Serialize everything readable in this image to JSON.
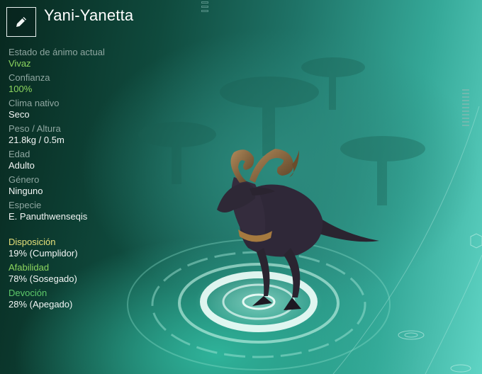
{
  "creature": {
    "name": "Yani-Yanetta"
  },
  "stats": [
    {
      "label": "Estado de ánimo actual",
      "value": "Vivaz",
      "highlight": true
    },
    {
      "label": "Confianza",
      "value": "100%",
      "highlight": true
    },
    {
      "label": "Clima nativo",
      "value": "Seco",
      "highlight": false
    },
    {
      "label": "Peso / Altura",
      "value": "21.8kg / 0.5m",
      "highlight": false
    },
    {
      "label": "Edad",
      "value": "Adulto",
      "highlight": false
    },
    {
      "label": "Género",
      "value": "Ninguno",
      "highlight": false
    },
    {
      "label": "Especie",
      "value": "E. Panuthwenseqis",
      "highlight": false
    }
  ],
  "traits": [
    {
      "label": "Disposición",
      "value": "19% (Cumplidor)",
      "color": "#e6e07a"
    },
    {
      "label": "Afabilidad",
      "value": "78% (Sosegado)",
      "color": "#8dd65f"
    },
    {
      "label": "Devoción",
      "value": "28% (Apegado)",
      "color": "#5ec96a"
    }
  ],
  "icons": {
    "edit": "pencil-icon"
  }
}
